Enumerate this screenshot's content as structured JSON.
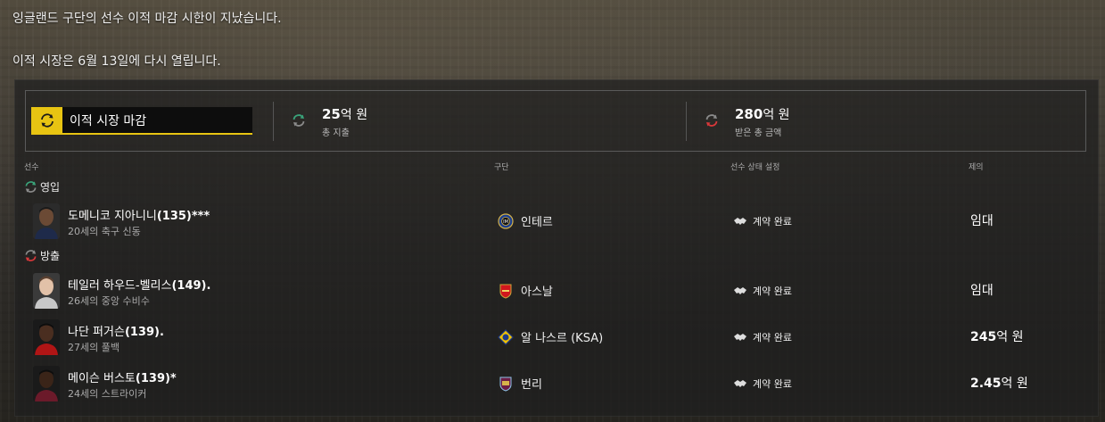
{
  "notices": {
    "line1": "잉글랜드 구단의 선수 이적 마감 시한이 지났습니다.",
    "line2": "이적 시장은 6월 13일에 다시 열립니다."
  },
  "summary": {
    "deadline_label": "이적 시장 마감",
    "spent": {
      "amount": "25",
      "unit": "억 원",
      "label": "총 지출"
    },
    "received": {
      "amount": "280",
      "unit": "억 원",
      "label": "받은 총 금액"
    }
  },
  "columns": {
    "player": "선수",
    "club": "구단",
    "status": "선수 상태 설정",
    "offer": "제의"
  },
  "sections": {
    "in": "영입",
    "out": "방출"
  },
  "transfers_in": [
    {
      "name": "도메니코 지아니니",
      "tag": "(135)***",
      "desc": "20세의 축구 신동",
      "club": "인테르",
      "status": "계약 완료",
      "offer_bold": "",
      "offer_text": "임대"
    }
  ],
  "transfers_out": [
    {
      "name": "테일러 하우드-벨리스",
      "tag": "(149).",
      "desc": "26세의 중앙 수비수",
      "club": "아스날",
      "status": "계약 완료",
      "offer_bold": "",
      "offer_text": "임대"
    },
    {
      "name": "나단 퍼거슨",
      "tag": "(139).",
      "desc": "27세의 풀백",
      "club": "알 나스르 (KSA)",
      "status": "계약 완료",
      "offer_bold": "245",
      "offer_text": "억 원"
    },
    {
      "name": "메이슨 버스토",
      "tag": "(139)*",
      "desc": "24세의 스트라이커",
      "club": "번리",
      "status": "계약 완료",
      "offer_bold": "2.45",
      "offer_text": "억 원"
    }
  ],
  "icons": {
    "deadline": "transfer-cycle-icon",
    "spent": "transfer-in-icon",
    "received": "transfer-out-icon",
    "status": "handshake-icon"
  },
  "colors": {
    "accent_yellow": "#e8c412",
    "in_green": "#3aa37a",
    "out_red": "#d9383a"
  }
}
